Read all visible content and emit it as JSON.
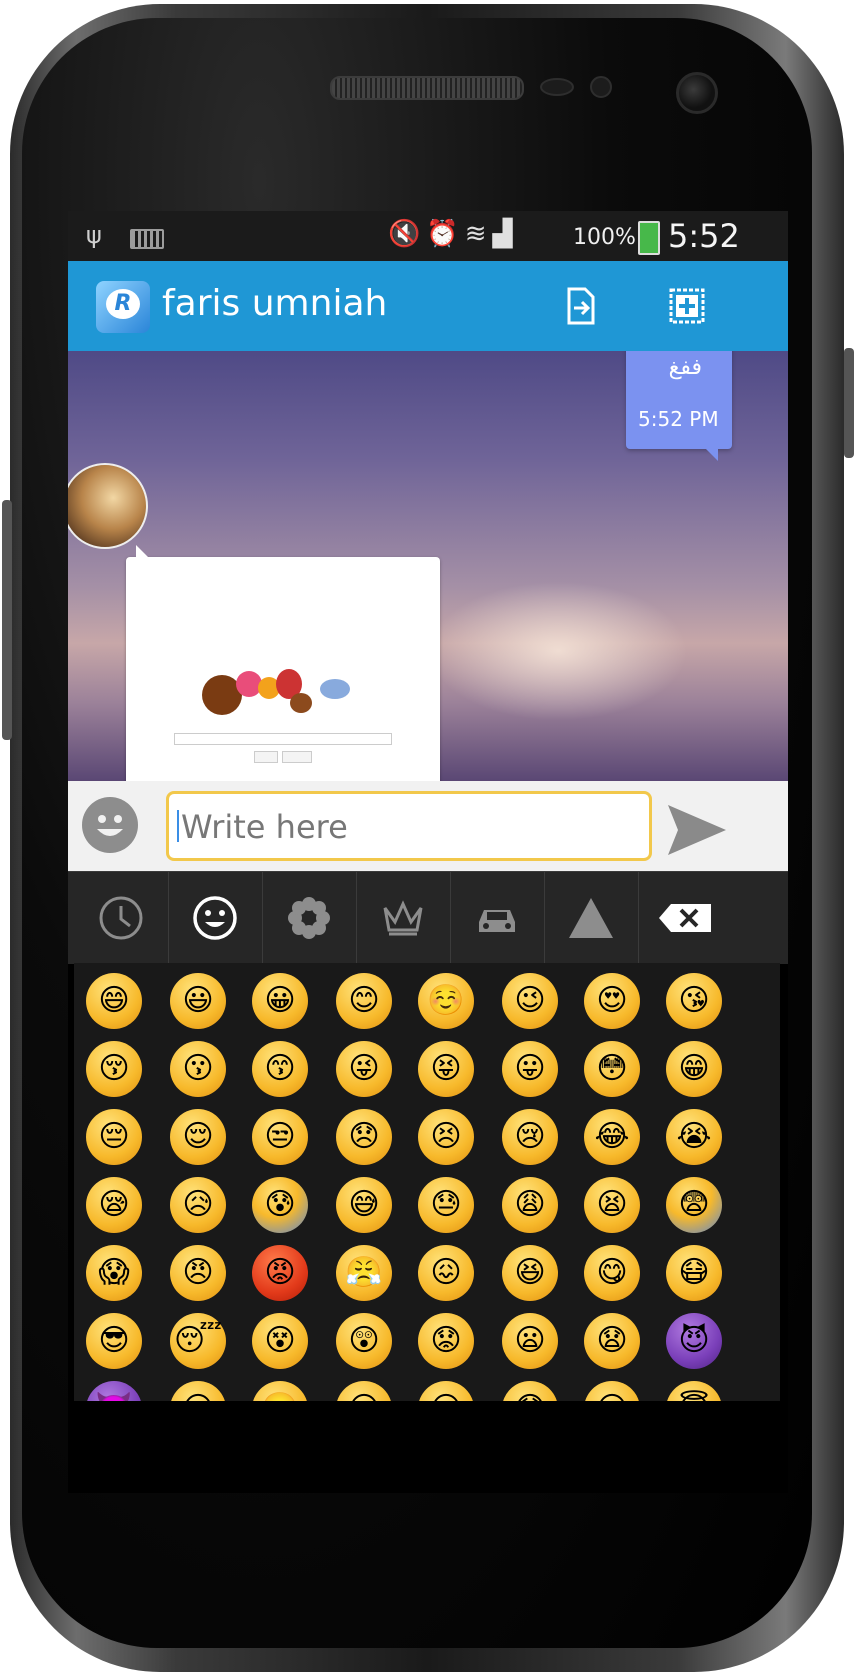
{
  "statusbar": {
    "usb_icon": "usb-icon",
    "keyboard_icon": "keyboard-icon",
    "battery_percent": "100%",
    "time": "5:52 PM"
  },
  "appbar": {
    "logo_letter": "R",
    "chat_name": "faris umniah",
    "attach_icon": "file-share-icon",
    "add_icon": "add-frame-icon",
    "color": "#1f97d5"
  },
  "messages": {
    "outgoing": {
      "text": "ففغ",
      "time": "5:52 PM",
      "color": "#7b92f0"
    },
    "incoming": {
      "type": "image",
      "content": "google-doodle-screenshot"
    }
  },
  "inputbar": {
    "placeholder": "Write here",
    "emoji_toggle_icon": "smiley-icon",
    "send_icon": "send-arrow-icon",
    "border_color": "#f2c84b"
  },
  "emoji_keyboard": {
    "tabs": [
      {
        "icon": "clock-icon"
      },
      {
        "icon": "smiley-icon",
        "active": true
      },
      {
        "icon": "flower-icon"
      },
      {
        "icon": "crown-icon"
      },
      {
        "icon": "car-icon"
      },
      {
        "icon": "triangle-icon"
      },
      {
        "icon": "backspace-icon"
      }
    ],
    "emojis": [
      [
        "😄",
        "😃",
        "😀",
        "😊",
        "☺️",
        "😉",
        "😍",
        "😘"
      ],
      [
        "😚",
        "😗",
        "😙",
        "😜",
        "😝",
        "😛",
        "😳",
        "😁"
      ],
      [
        "😔",
        "😌",
        "😒",
        "😞",
        "😣",
        "😢",
        "😂",
        "😭"
      ],
      [
        "😪",
        "😥",
        "😰",
        "😅",
        "😓",
        "😩",
        "😫",
        "😨"
      ],
      [
        "😱",
        "😠",
        "😡",
        "😤",
        "😖",
        "😆",
        "😋",
        "😷"
      ],
      [
        "😎",
        "😴",
        "😵",
        "😲",
        "😟",
        "😦",
        "😧",
        "😈"
      ],
      [
        "👿",
        "😮",
        "😬",
        "😐",
        "😕",
        "😯",
        "😶",
        "😇"
      ]
    ]
  }
}
